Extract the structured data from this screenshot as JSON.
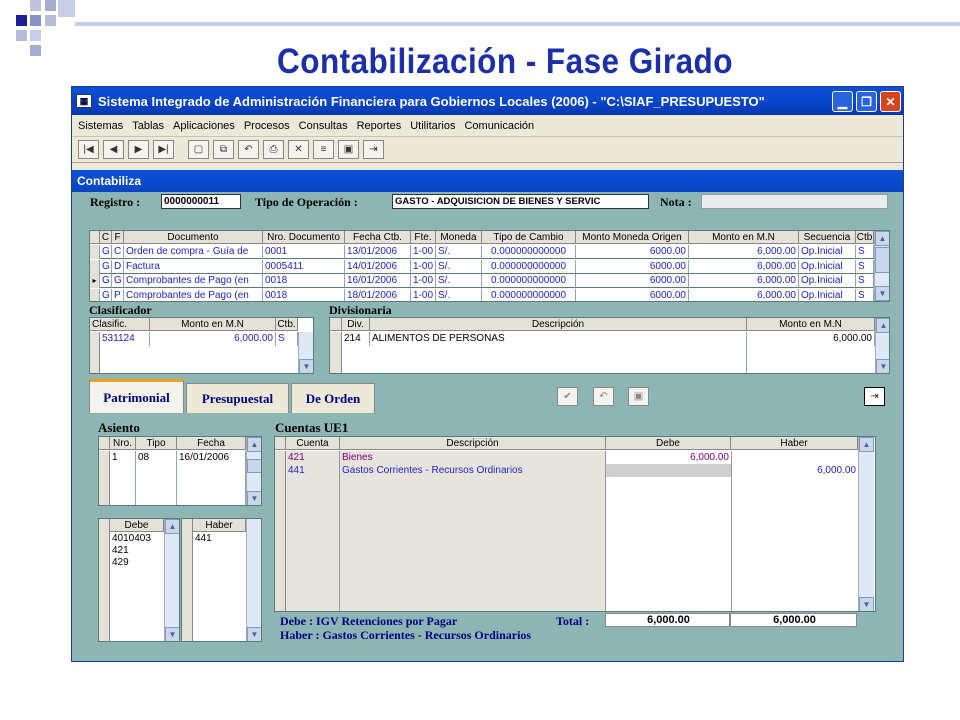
{
  "slide": {
    "title": "Contabilización - Fase Girado"
  },
  "window": {
    "title": "Sistema Integrado de Administración Financiera para Gobiernos Locales (2006) - \"C:\\SIAF_PRESUPUESTO\""
  },
  "menu": [
    "Sistemas",
    "Tablas",
    "Aplicaciones",
    "Procesos",
    "Consultas",
    "Reportes",
    "Utilitarios",
    "Comunicación"
  ],
  "form": {
    "title": "Contabiliza",
    "registro_label": "Registro :",
    "registro_value": "0000000011",
    "tipo_label": "Tipo de Operación :",
    "tipo_value": "GASTO - ADQUISICION DE BIENES Y SERVIC",
    "nota_label": "Nota :",
    "nota_value": ""
  },
  "documents": {
    "headers": [
      "C",
      "F",
      "Documento",
      "Nro. Documento",
      "Fecha Ctb.",
      "Fte.",
      "Moneda",
      "Tipo de Cambio",
      "Monto Moneda Origen",
      "Monto en M.N",
      "Secuencia",
      "Ctb"
    ],
    "rows": [
      [
        "G",
        "C",
        "Orden de compra - Guía de",
        "0001",
        "13/01/2006",
        "1-00",
        "S/.",
        "0.000000000000",
        "6000.00",
        "6,000.00",
        "Op.Inicial",
        "S"
      ],
      [
        "G",
        "D",
        "Factura",
        "0005411",
        "14/01/2006",
        "1-00",
        "S/.",
        "0.000000000000",
        "6000.00",
        "6,000.00",
        "Op.Inicial",
        "S"
      ],
      [
        "G",
        "G",
        "Comprobantes de Pago (en",
        "0018",
        "16/01/2006",
        "1-00",
        "S/.",
        "0.000000000000",
        "6000.00",
        "6,000.00",
        "Op.Inicial",
        "S"
      ],
      [
        "G",
        "P",
        "Comprobantes de Pago (en",
        "0018",
        "18/01/2006",
        "1-00",
        "S/.",
        "0.000000000000",
        "6000.00",
        "6,000.00",
        "Op.Inicial",
        "S"
      ]
    ],
    "current_row_marker": "▸"
  },
  "clasificador": {
    "title": "Clasificador",
    "headers": [
      "Clasific.",
      "Monto en M.N",
      "Ctb."
    ],
    "row": [
      "531124",
      "6,000.00",
      "S"
    ]
  },
  "divisionaria": {
    "title": "Divisionaria",
    "headers": [
      "Div.",
      "Descripción",
      "Monto en M.N"
    ],
    "row": [
      "214",
      "ALIMENTOS DE PERSONAS",
      "6,000.00"
    ]
  },
  "tabs": [
    "Patrimonial",
    "Presupuestal",
    "De Orden"
  ],
  "asiento": {
    "title": "Asiento",
    "headers": [
      "Nro.",
      "Tipo",
      "Fecha"
    ],
    "row": [
      "1",
      "08",
      "16/01/2006"
    ]
  },
  "debe_haber": {
    "debe_header": "Debe",
    "haber_header": "Haber",
    "debe_values": [
      "4010403",
      "421",
      "429"
    ],
    "haber_values": [
      "441"
    ]
  },
  "cuentas": {
    "title": "Cuentas UE1",
    "headers": [
      "Cuenta",
      "Descripción",
      "Debe",
      "Haber"
    ],
    "rows": [
      [
        "421",
        "Bienes",
        "6,000.00",
        ""
      ],
      [
        "441",
        "Gastos Corrientes - Recursos Ordinarios",
        "",
        "6,000.00"
      ]
    ]
  },
  "footer": {
    "debe_text": "Debe : IGV Retenciones por Pagar",
    "haber_text": "Haber : Gastos Corrientes - Recursos Ordinarios",
    "total_label": "Total :",
    "total_debe": "6,000.00",
    "total_haber": "6,000.00"
  },
  "colors": {
    "slide_title": "#1a2fa8",
    "window_bg": "#8db5b3",
    "titlebar": "#0843c6",
    "link_blue": "#1f1fcc",
    "purple": "#800080"
  }
}
